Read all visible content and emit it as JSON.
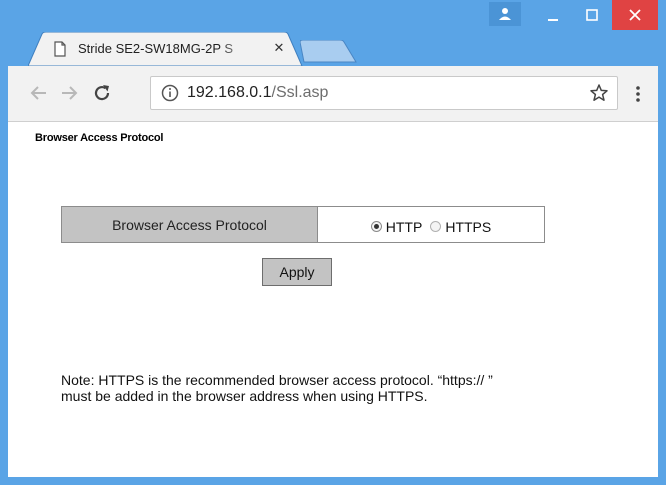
{
  "browser": {
    "tab": {
      "title": "Stride SE2-SW18MG-2P S"
    },
    "address": {
      "host": "192.168.0.1",
      "path": "/Ssl.asp"
    }
  },
  "page": {
    "heading": "Browser Access Protocol",
    "protocol_row": {
      "label": "Browser Access Protocol",
      "options": [
        {
          "label": "HTTP",
          "checked": true
        },
        {
          "label": "HTTPS",
          "checked": false
        }
      ]
    },
    "apply_label": "Apply",
    "note_line1": "Note: HTTPS is the recommended browser access protocol. “https:// ”",
    "note_line2": "must be added in the browser address when using HTTPS."
  },
  "colors": {
    "titlebar": "#5aa4e6",
    "close_button": "#e04343",
    "label_cell": "#c3c3c3"
  },
  "icons": [
    "document-icon",
    "tab-close-icon",
    "profile-icon",
    "minimize-icon",
    "maximize-icon",
    "window-close-icon",
    "back-arrow-icon",
    "forward-arrow-icon",
    "reload-icon",
    "info-icon",
    "star-icon",
    "menu-icon"
  ]
}
